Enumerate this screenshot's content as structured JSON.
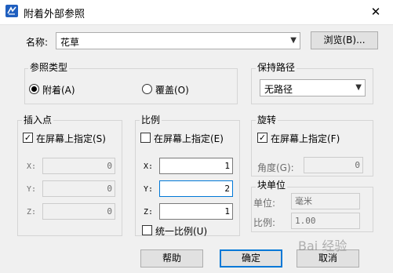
{
  "window": {
    "title": "附着外部参照",
    "close_glyph": "✕",
    "app_icon": "app-logo-icon"
  },
  "name": {
    "label": "名称:",
    "value": "花草",
    "browse_label": "浏览(B)..."
  },
  "reference_type": {
    "title": "参照类型",
    "attach_label": "附着(A)",
    "overlay_label": "覆盖(O)",
    "selected": "attach"
  },
  "keep_path": {
    "title": "保持路径",
    "value": "无路径"
  },
  "insertion_point": {
    "title": "插入点",
    "specify_label": "在屏幕上指定(S)",
    "specify_checked": true,
    "x_label": "X:",
    "x_value": "0",
    "y_label": "Y:",
    "y_value": "0",
    "z_label": "Z:",
    "z_value": "0"
  },
  "scale": {
    "title": "比例",
    "specify_label": "在屏幕上指定(E)",
    "specify_checked": false,
    "x_label": "X:",
    "x_value": "1",
    "y_label": "Y:",
    "y_value": "2",
    "z_label": "Z:",
    "z_value": "1",
    "uniform_label": "统一比例(U)",
    "uniform_checked": false
  },
  "rotation": {
    "title": "旋转",
    "specify_label": "在屏幕上指定(F)",
    "specify_checked": true,
    "angle_label": "角度(G):",
    "angle_value": "0"
  },
  "block_unit": {
    "title": "块单位",
    "unit_label": "单位:",
    "unit_value": "毫米",
    "scale_label": "比例:",
    "scale_value": "1.00"
  },
  "buttons": {
    "help": "帮助",
    "ok": "确定",
    "cancel": "取消"
  },
  "watermark": "Bai 经验"
}
